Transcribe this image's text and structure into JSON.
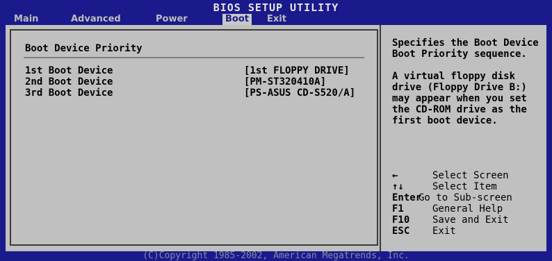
{
  "title": "BIOS SETUP UTILITY",
  "tabs": [
    {
      "label": "Main",
      "active": false
    },
    {
      "label": "Advanced",
      "active": false
    },
    {
      "label": "Power",
      "active": false
    },
    {
      "label": "Boot",
      "active": true
    },
    {
      "label": "Exit",
      "active": false
    }
  ],
  "section": {
    "title": "Boot Device Priority",
    "rows": [
      {
        "label": "1st Boot Device",
        "value": "[1st FLOPPY DRIVE]"
      },
      {
        "label": "2nd Boot Device",
        "value": "[PM-ST320410A]"
      },
      {
        "label": "3rd Boot Device",
        "value": "[PS-ASUS CD-S520/A]"
      }
    ]
  },
  "help": {
    "para1": "Specifies the Boot Device Boot Priority sequence.",
    "para2": "A virtual floppy disk drive (Floppy Drive B:) may appear when you set the CD-ROM drive as the first boot device."
  },
  "keys": [
    {
      "key": "←",
      "desc": "Select Screen",
      "icon": "arrow-left-icon"
    },
    {
      "key": "↑↓",
      "desc": "Select Item",
      "icon": "arrow-up-down-icon"
    },
    {
      "key": "Enter",
      "desc": "Go to Sub-screen"
    },
    {
      "key": "F1",
      "desc": "General Help"
    },
    {
      "key": "F10",
      "desc": "Save and Exit"
    },
    {
      "key": "ESC",
      "desc": "Exit"
    }
  ],
  "footer": "(C)Copyright 1985-2002, American Megatrends, Inc.",
  "colors": {
    "background": "#1a1a8c",
    "panel": "#c0c0c0",
    "text": "#000000"
  }
}
